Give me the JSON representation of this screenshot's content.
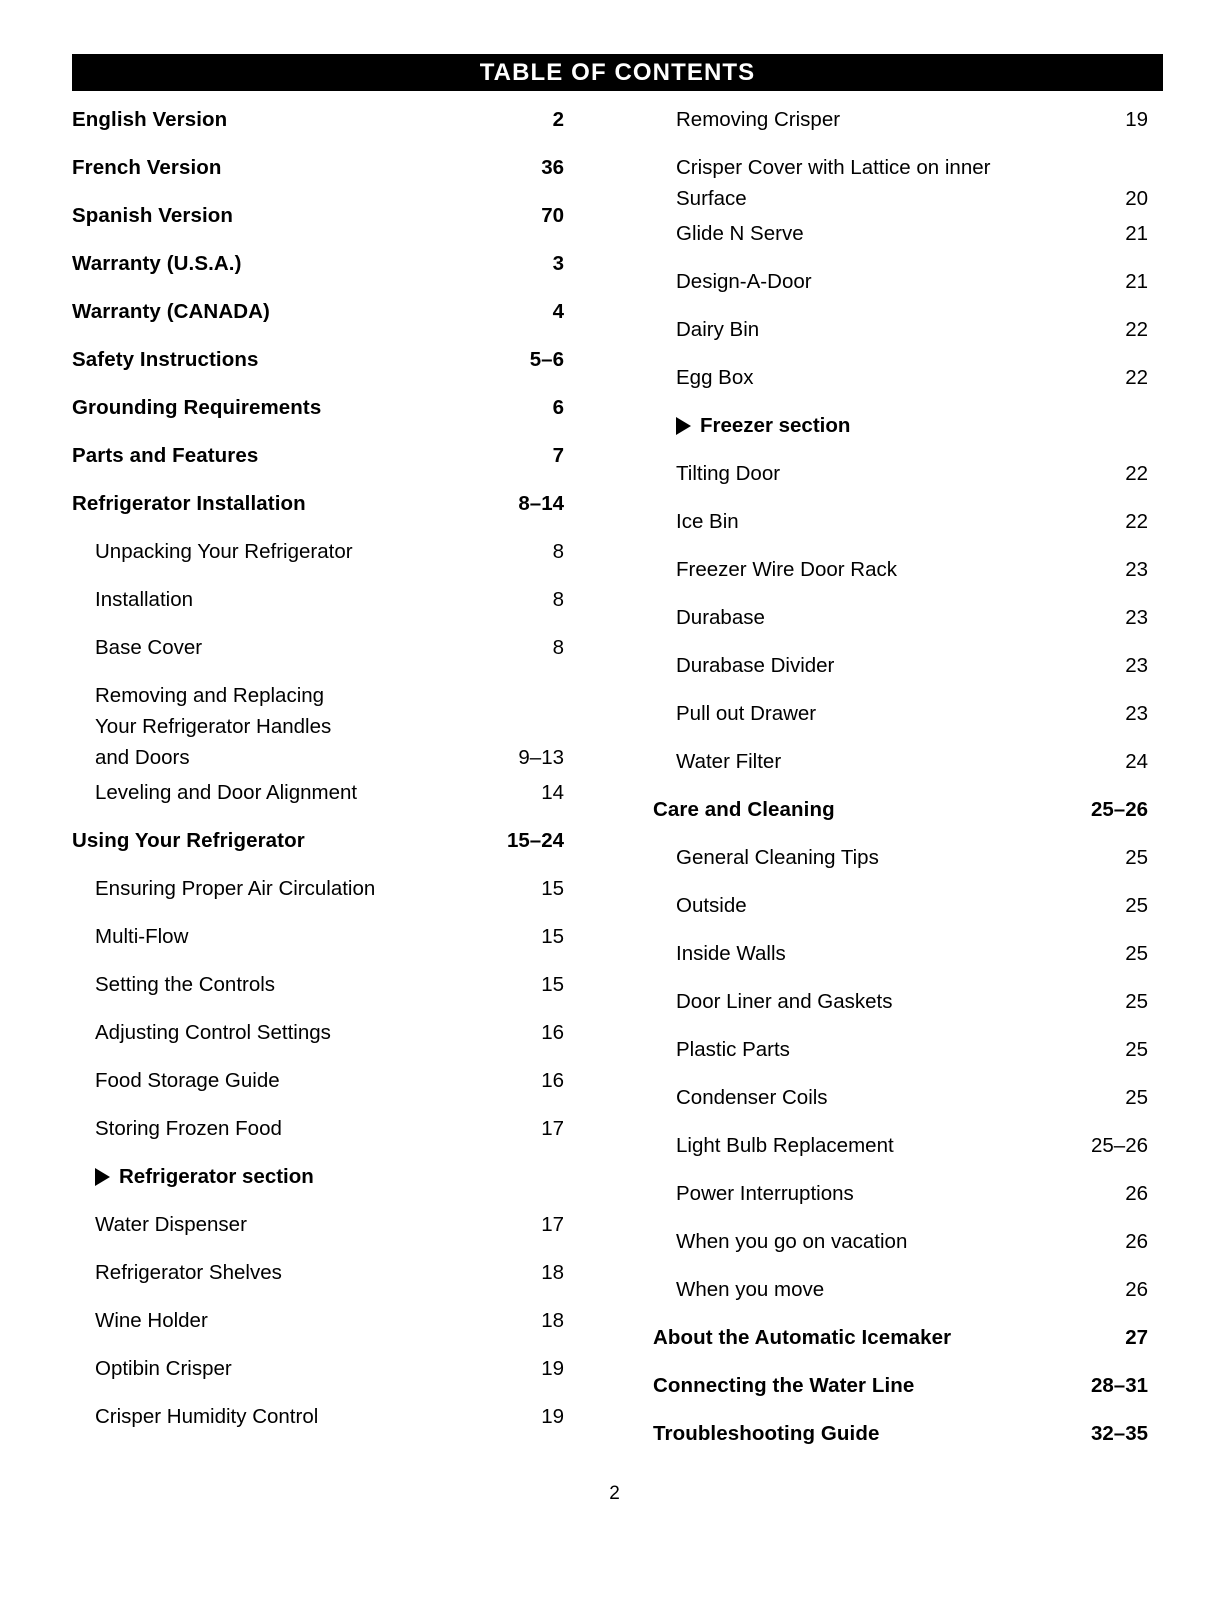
{
  "header": {
    "title": "TABLE OF CONTENTS"
  },
  "footer": {
    "page_number": "2"
  },
  "colors": {
    "header_background": "#000000",
    "header_text": "#ffffff",
    "body_text": "#000000",
    "page_background": "#ffffff"
  },
  "icons": {
    "section_marker": "triangle-right-icon"
  },
  "left_column": {
    "entries": [
      {
        "label": "English Version",
        "page": "2",
        "level": 1
      },
      {
        "label": "French Version",
        "page": "36",
        "level": 1
      },
      {
        "label": "Spanish Version",
        "page": "70",
        "level": 1
      },
      {
        "label": "Warranty (U.S.A.)",
        "page": "3",
        "level": 1
      },
      {
        "label": "Warranty (CANADA)",
        "page": "4",
        "level": 1
      },
      {
        "label": "Safety Instructions",
        "page": "5–6",
        "level": 1
      },
      {
        "label": "Grounding Requirements",
        "page": "6",
        "level": 1
      },
      {
        "label": "Parts and Features",
        "page": "7",
        "level": 1
      },
      {
        "label": "Refrigerator Installation",
        "page": "8–14",
        "level": 1
      },
      {
        "label": "Unpacking Your Refrigerator",
        "page": "8",
        "level": 2
      },
      {
        "label": "Installation",
        "page": "8",
        "level": 2
      },
      {
        "label": "Base Cover",
        "page": "8",
        "level": 2
      },
      {
        "label": "Removing and Replacing\nYour Refrigerator Handles\nand Doors",
        "page": "9–13",
        "level": 2,
        "multiline": true
      },
      {
        "label": "Leveling and Door Alignment",
        "page": "14",
        "level": 2
      },
      {
        "label": "Using Your Refrigerator",
        "page": "15–24",
        "level": 1
      },
      {
        "label": "Ensuring Proper Air Circulation",
        "page": "15",
        "level": 2
      },
      {
        "label": "Multi-Flow",
        "page": "15",
        "level": 2
      },
      {
        "label": "Setting the Controls",
        "page": "15",
        "level": 2
      },
      {
        "label": "Adjusting Control Settings",
        "page": "16",
        "level": 2
      },
      {
        "label": "Food Storage Guide",
        "page": "16",
        "level": 2
      },
      {
        "label": "Storing Frozen Food",
        "page": "17",
        "level": 2
      },
      {
        "label": "Refrigerator section",
        "page": "",
        "level": 2,
        "marker": true
      },
      {
        "label": "Water Dispenser",
        "page": "17",
        "level": 2
      },
      {
        "label": "Refrigerator Shelves",
        "page": "18",
        "level": 2
      },
      {
        "label": "Wine Holder",
        "page": "18",
        "level": 2
      },
      {
        "label": "Optibin Crisper",
        "page": "19",
        "level": 2
      },
      {
        "label": "Crisper Humidity Control",
        "page": "19",
        "level": 2
      }
    ]
  },
  "right_column": {
    "entries": [
      {
        "label": "Removing Crisper",
        "page": "19",
        "level": 2
      },
      {
        "label": "Crisper Cover with Lattice on inner\nSurface",
        "page": "20",
        "level": 2,
        "multiline": true
      },
      {
        "label": "Glide N Serve",
        "page": "21",
        "level": 2
      },
      {
        "label": "Design-A-Door",
        "page": "21",
        "level": 2
      },
      {
        "label": "Dairy Bin",
        "page": "22",
        "level": 2
      },
      {
        "label": "Egg Box",
        "page": "22",
        "level": 2
      },
      {
        "label": "Freezer section",
        "page": "",
        "level": 2,
        "marker": true
      },
      {
        "label": "Tilting Door",
        "page": "22",
        "level": 2
      },
      {
        "label": "Ice Bin",
        "page": "22",
        "level": 2
      },
      {
        "label": "Freezer Wire Door Rack",
        "page": "23",
        "level": 2
      },
      {
        "label": "Durabase",
        "page": "23",
        "level": 2
      },
      {
        "label": "Durabase Divider",
        "page": "23",
        "level": 2
      },
      {
        "label": "Pull out Drawer",
        "page": "23",
        "level": 2
      },
      {
        "label": "Water Filter",
        "page": "24",
        "level": 2
      },
      {
        "label": "Care and Cleaning",
        "page": "25–26",
        "level": 1
      },
      {
        "label": "General Cleaning Tips",
        "page": "25",
        "level": 2
      },
      {
        "label": "Outside",
        "page": "25",
        "level": 2
      },
      {
        "label": "Inside Walls",
        "page": "25",
        "level": 2
      },
      {
        "label": "Door Liner and Gaskets",
        "page": "25",
        "level": 2
      },
      {
        "label": "Plastic Parts",
        "page": "25",
        "level": 2
      },
      {
        "label": "Condenser Coils",
        "page": "25",
        "level": 2
      },
      {
        "label": "Light Bulb Replacement",
        "page": "25–26",
        "level": 2
      },
      {
        "label": "Power Interruptions",
        "page": "26",
        "level": 2
      },
      {
        "label": "When you go on vacation",
        "page": "26",
        "level": 2
      },
      {
        "label": "When you move",
        "page": "26",
        "level": 2
      },
      {
        "label": "About the Automatic Icemaker",
        "page": "27",
        "level": 1
      },
      {
        "label": "Connecting the Water Line",
        "page": "28–31",
        "level": 1
      },
      {
        "label": "Troubleshooting Guide",
        "page": "32–35",
        "level": 1
      }
    ]
  }
}
